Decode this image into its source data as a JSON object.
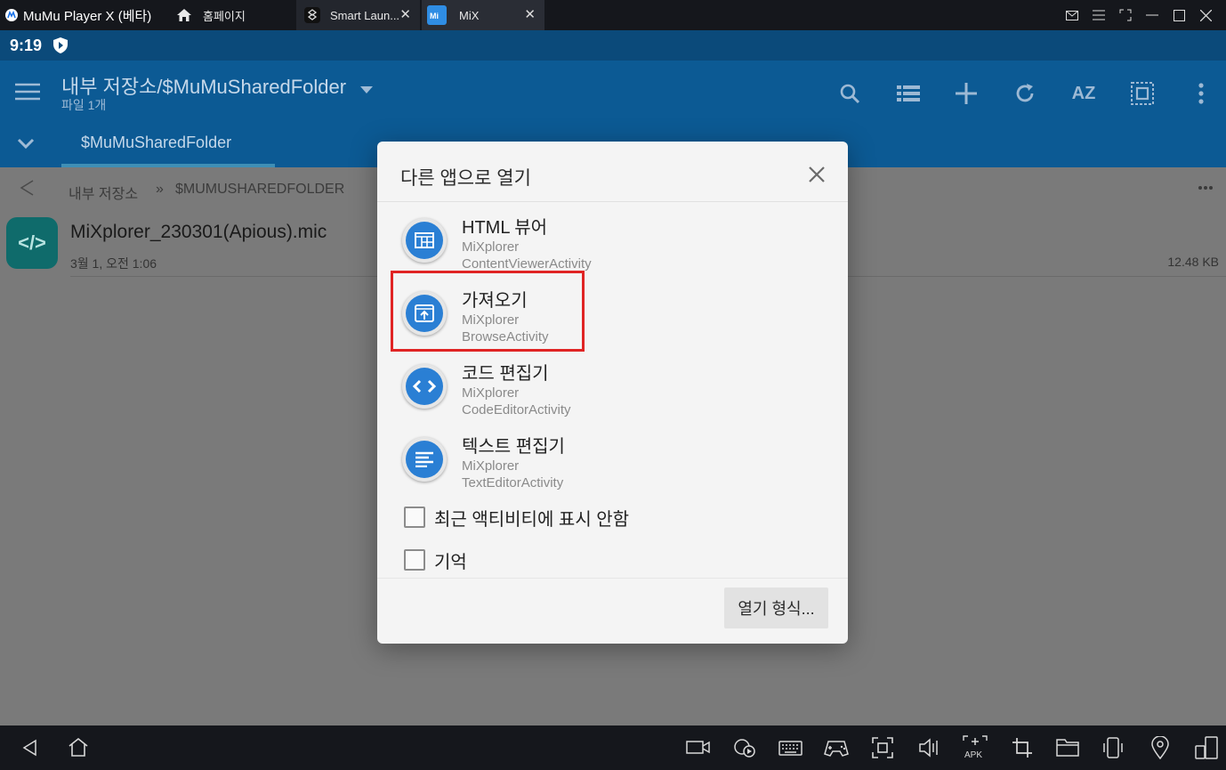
{
  "host": {
    "app_title": "MuMu Player X (베타)",
    "tabs": [
      {
        "label": "홈페이지"
      },
      {
        "label": "Smart Laun..."
      },
      {
        "label": "MiX"
      }
    ]
  },
  "status": {
    "time": "9:19"
  },
  "appbar": {
    "path": "내부 저장소/$MuMuSharedFolder",
    "subtitle": "파일 1개",
    "sort_label": "AZ",
    "folder_tab": "$MuMuSharedFolder"
  },
  "breadcrumb": {
    "root": "내부 저장소",
    "separator": "»",
    "current": "$MUMUSHAREDFOLDER"
  },
  "file": {
    "icon_glyph": "</>",
    "name": "MiXplorer_230301(Apious).mic",
    "date": "3월 1, 오전 1:06",
    "size": "12.48  KB"
  },
  "dialog": {
    "title": "다른 앱으로 열기",
    "options": [
      {
        "name": "HTML 뷰어",
        "app": "MiXplorer",
        "activity": "ContentViewerActivity",
        "icon": "html-viewer-icon"
      },
      {
        "name": "가져오기",
        "app": "MiXplorer",
        "activity": "BrowseActivity",
        "icon": "import-icon"
      },
      {
        "name": "코드 편집기",
        "app": "MiXplorer",
        "activity": "CodeEditorActivity",
        "icon": "code-editor-icon"
      },
      {
        "name": "텍스트 편집기",
        "app": "MiXplorer",
        "activity": "TextEditorActivity",
        "icon": "text-editor-icon"
      }
    ],
    "checkbox_recent": "최근 액티비티에 표시 안함",
    "checkbox_remember": "기억",
    "open_as_button": "열기 형식..."
  },
  "colors": {
    "appbar": "#0c5a94",
    "highlight": "#e02424",
    "icon_blue": "#2a7fd4"
  }
}
